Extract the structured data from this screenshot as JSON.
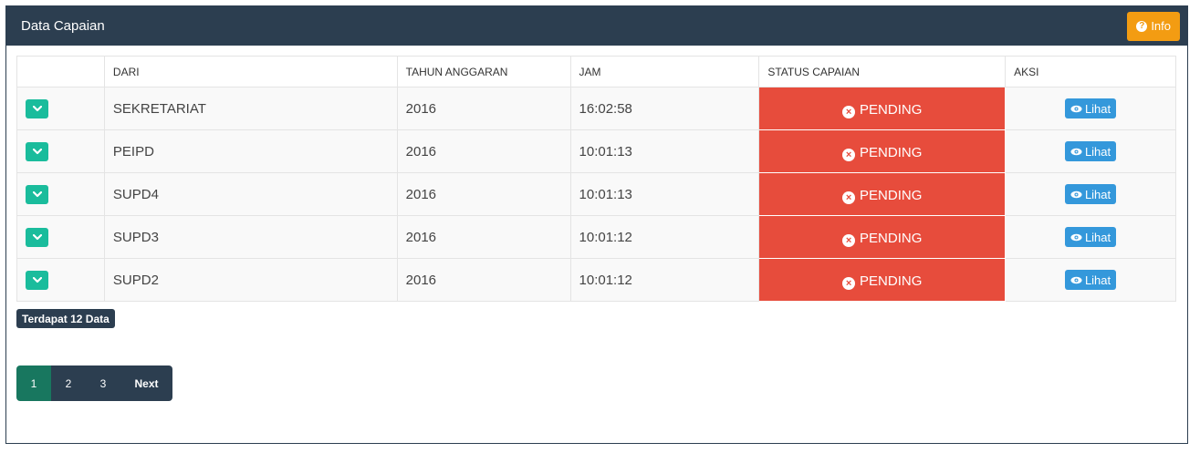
{
  "panel": {
    "title": "Data Capaian",
    "info_label": "Info"
  },
  "table": {
    "headers": [
      "",
      "DARI",
      "TAHUN ANGGARAN",
      "JAM",
      "STATUS CAPAIAN",
      "AKSI"
    ],
    "rows": [
      {
        "dari": "SEKRETARIAT",
        "tahun": "2016",
        "jam": "16:02:58",
        "status": "PENDING",
        "aksi": "Lihat"
      },
      {
        "dari": "PEIPD",
        "tahun": "2016",
        "jam": "10:01:13",
        "status": "PENDING",
        "aksi": "Lihat"
      },
      {
        "dari": "SUPD4",
        "tahun": "2016",
        "jam": "10:01:13",
        "status": "PENDING",
        "aksi": "Lihat"
      },
      {
        "dari": "SUPD3",
        "tahun": "2016",
        "jam": "10:01:12",
        "status": "PENDING",
        "aksi": "Lihat"
      },
      {
        "dari": "SUPD2",
        "tahun": "2016",
        "jam": "10:01:12",
        "status": "PENDING",
        "aksi": "Lihat"
      }
    ]
  },
  "count_badge": "Terdapat 12 Data",
  "pagination": {
    "pages": [
      "1",
      "2",
      "3"
    ],
    "active": "1",
    "next": "Next"
  },
  "colors": {
    "header": "#2c3e50",
    "info": "#f39c12",
    "toggle": "#1abc9c",
    "pending": "#e74c3c",
    "lihat": "#3498db"
  }
}
